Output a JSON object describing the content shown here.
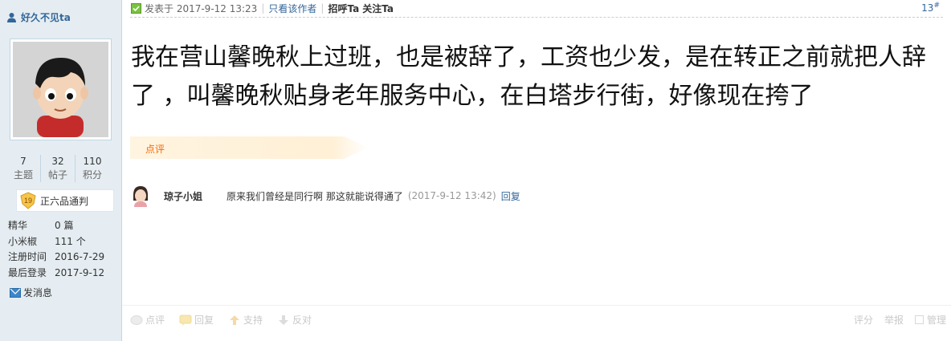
{
  "author": {
    "name": "好久不见ta",
    "stats": [
      {
        "num": "7",
        "label": "主题"
      },
      {
        "num": "32",
        "label": "帖子"
      },
      {
        "num": "110",
        "label": "积分"
      }
    ],
    "rank_level": "19",
    "rank_title": "正六品通判",
    "info": [
      {
        "key": "精华",
        "value": "0 篇"
      },
      {
        "key": "小米椒",
        "value": "111 个"
      },
      {
        "key": "注册时间",
        "value": "2016-7-29"
      },
      {
        "key": "最后登录",
        "value": "2017-9-12"
      }
    ],
    "message_label": "发消息"
  },
  "post": {
    "posted_label": "发表于 2017-9-12 13:23",
    "only_author": "只看该作者",
    "greet": "招呼Ta",
    "follow": "关注Ta",
    "floor_num": "13",
    "floor_mark": "#",
    "body": "我在营山馨晚秋上过班，也是被辞了，工资也少发，是在转正之前就把人辞了 ，叫馨晚秋贴身老年服务中心，在白塔步行街，好像现在挎了",
    "comment_tab": "点评"
  },
  "comment": {
    "user": "琼子小姐",
    "text": "原来我们曾经是同行啊 那这就能说得通了",
    "time": "(2017-9-12 13:42)",
    "reply": "回复"
  },
  "actions": {
    "left": [
      "点评",
      "回复",
      "支持",
      "反对"
    ],
    "right": [
      "评分",
      "举报",
      "管理"
    ]
  },
  "colors": {
    "sidebar_bg": "#e5edf2",
    "link": "#336699",
    "accent": "#ff6600"
  }
}
